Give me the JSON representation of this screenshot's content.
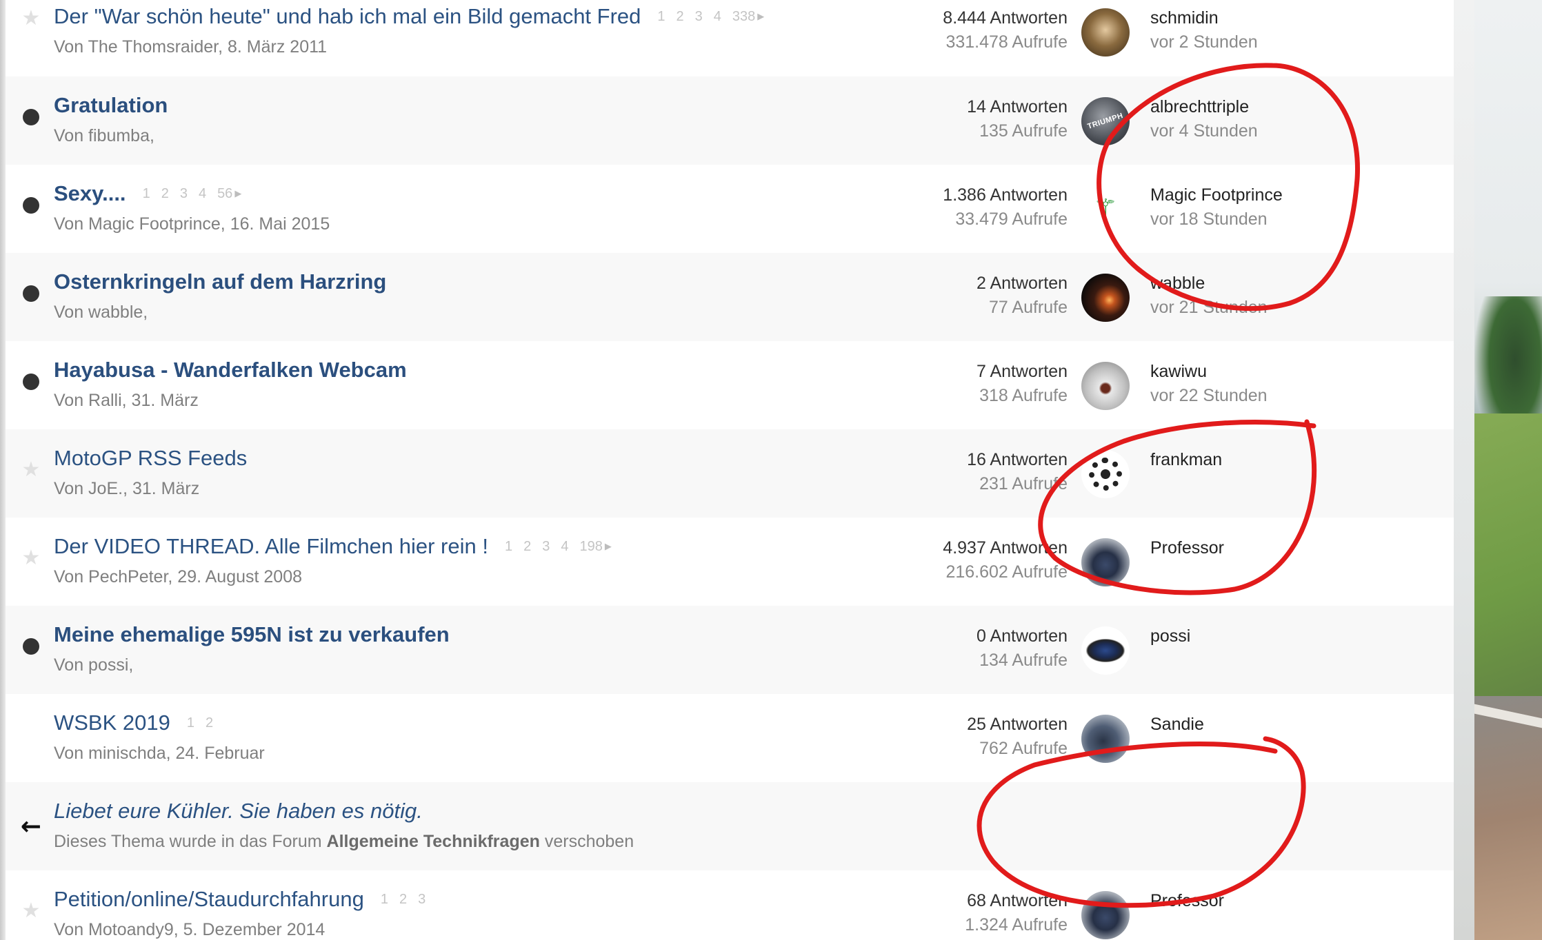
{
  "threads": [
    {
      "status": "star",
      "title": "Der \"War schön heute\" und hab ich mal ein Bild gemacht Fred",
      "unread": false,
      "pages": [
        "1",
        "2",
        "3",
        "4",
        "338"
      ],
      "meta": "Von The Thomsraider, 8. März 2011",
      "replies": "8.444 Antworten",
      "views": "331.478 Aufrufe",
      "avatar_icon": "avatar-photo-schmidin",
      "last_user": "schmidin",
      "last_time": "vor 2 Stunden"
    },
    {
      "status": "dot",
      "title": "Gratulation",
      "unread": true,
      "pages": [],
      "meta": "Von fibumba,",
      "replies": "14 Antworten",
      "views": "135 Aufrufe",
      "avatar_icon": "avatar-triumph-logo",
      "avatar_text": "TRIUMPH",
      "last_user": "albrechttriple",
      "last_time": "vor 4 Stunden"
    },
    {
      "status": "dot",
      "title": "Sexy....",
      "unread": true,
      "pages": [
        "1",
        "2",
        "3",
        "4",
        "56"
      ],
      "meta": "Von Magic Footprince, 16. Mai 2015",
      "replies": "1.386 Antworten",
      "views": "33.479 Aufrufe",
      "avatar_icon": "avatar-green-emblem",
      "last_user": "Magic Footprince",
      "last_time": "vor 18 Stunden"
    },
    {
      "status": "dot",
      "title": "Osternkringeln auf dem Harzring",
      "unread": true,
      "pages": [],
      "meta": "Von wabble,",
      "replies": "2 Antworten",
      "views": "77 Aufrufe",
      "avatar_icon": "avatar-sunset",
      "last_user": "wabble",
      "last_time": "vor 21 Stunden"
    },
    {
      "status": "dot",
      "title": "Hayabusa - Wanderfalken Webcam",
      "unread": true,
      "pages": [],
      "meta": "Von Ralli, 31. März",
      "replies": "7 Antworten",
      "views": "318 Aufrufe",
      "avatar_icon": "avatar-cat",
      "last_user": "kawiwu",
      "last_time": "vor 22 Stunden"
    },
    {
      "status": "star",
      "title": "MotoGP RSS Feeds",
      "unread": false,
      "pages": [],
      "meta": "Von JoE., 31. März",
      "replies": "16 Antworten",
      "views": "231 Aufrufe",
      "avatar_icon": "avatar-ornament",
      "last_user": "frankman",
      "last_time": ""
    },
    {
      "status": "star",
      "title": "Der VIDEO THREAD. Alle Filmchen hier rein !",
      "unread": false,
      "pages": [
        "1",
        "2",
        "3",
        "4",
        "198"
      ],
      "meta": "Von PechPeter, 29. August 2008",
      "replies": "4.937 Antworten",
      "views": "216.602 Aufrufe",
      "avatar_icon": "avatar-motorbike",
      "last_user": "Professor",
      "last_time": ""
    },
    {
      "status": "dot",
      "title": "Meine ehemalige 595N ist zu verkaufen",
      "unread": true,
      "pages": [],
      "meta": "Von possi,",
      "replies": "0 Antworten",
      "views": "134 Aufrufe",
      "avatar_icon": "avatar-motorbike-blue",
      "last_user": "possi",
      "last_time": ""
    },
    {
      "status": "none",
      "title": "WSBK 2019",
      "unread": false,
      "pages": [
        "1",
        "2"
      ],
      "meta": "Von minischda, 24. Februar",
      "replies": "25 Antworten",
      "views": "762 Aufrufe",
      "avatar_icon": "avatar-motorbike-rider",
      "last_user": "Sandie",
      "last_time": ""
    },
    {
      "status": "moved",
      "title": "Liebet eure Kühler. Sie haben es nötig.",
      "moved": true,
      "meta_prefix": "Dieses Thema wurde in das Forum",
      "meta_forum": "Allgemeine Technikfragen",
      "meta_suffix": "verschoben"
    },
    {
      "status": "star",
      "title": "Petition/online/Staudurchfahrung",
      "unread": false,
      "pages": [
        "1",
        "2",
        "3"
      ],
      "meta": "Von Motoandy9, 5. Dezember 2014",
      "replies": "68 Antworten",
      "views": "1.324 Aufrufe",
      "avatar_icon": "avatar-motorbike",
      "last_user": "Professor",
      "last_time": ""
    }
  ],
  "colors": {
    "link": "#2b5282",
    "annotation": "#e11b1b"
  }
}
